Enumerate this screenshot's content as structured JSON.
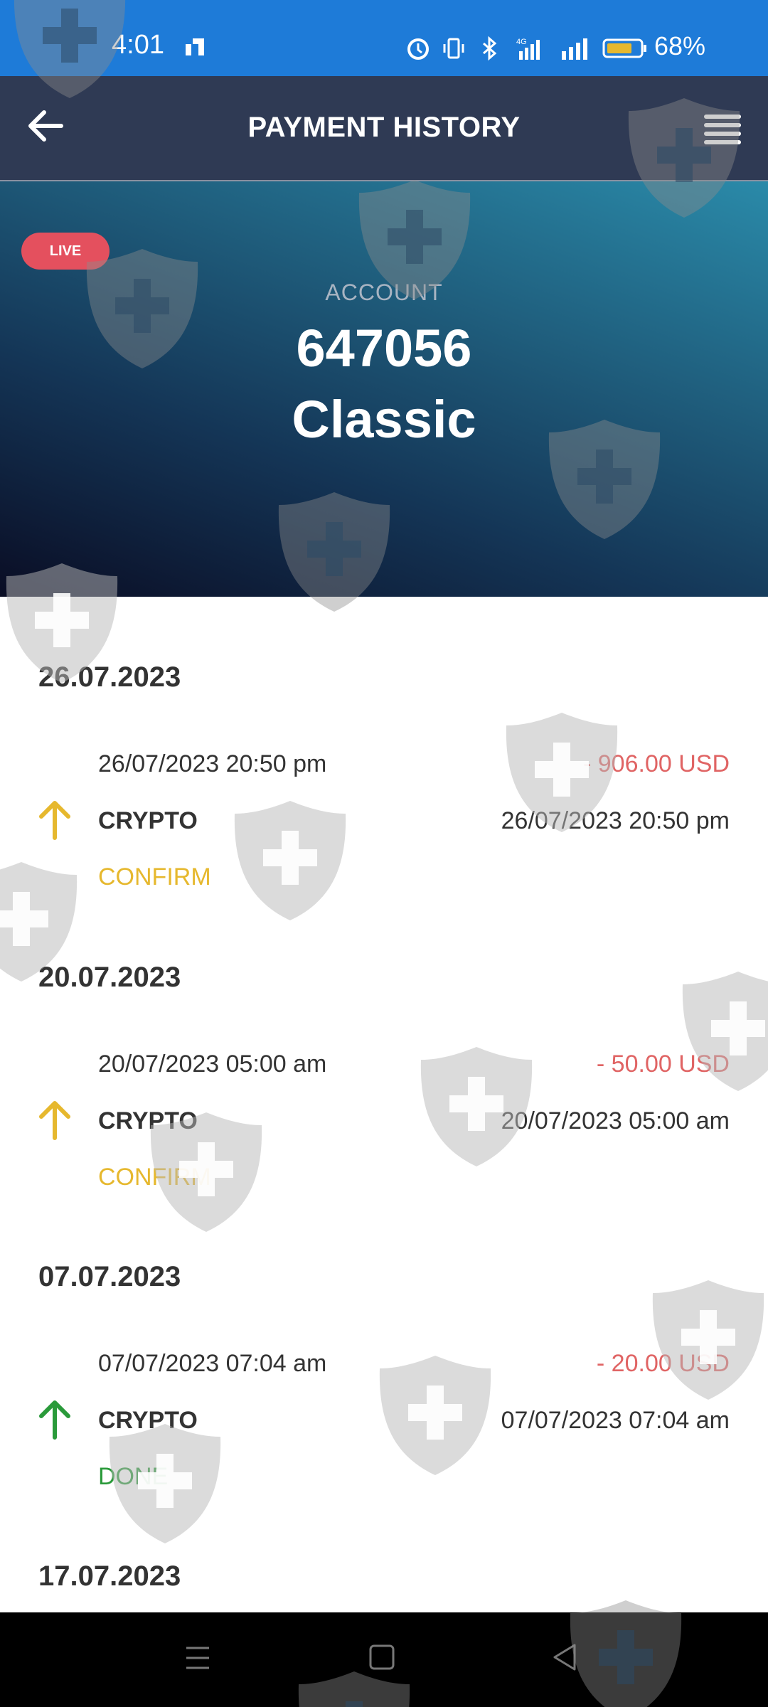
{
  "status_bar": {
    "time": "4:01",
    "battery_percent": "68%"
  },
  "header": {
    "title": "PAYMENT HISTORY"
  },
  "account": {
    "badge": "LIVE",
    "label": "ACCOUNT",
    "number": "647056",
    "type": "Classic"
  },
  "groups": [
    {
      "date": "26.07.2023",
      "transactions": [
        {
          "datetime": "26/07/2023 20:50 pm",
          "amount": "- 906.00 USD",
          "method": "CRYPTO",
          "datetime_secondary": "26/07/2023 20:50 pm",
          "status": "CONFIRM",
          "status_color": "#e6b82e",
          "icon": "arrow-up-icon"
        }
      ]
    },
    {
      "date": "20.07.2023",
      "transactions": [
        {
          "datetime": "20/07/2023 05:00 am",
          "amount": "- 50.00 USD",
          "method": "CRYPTO",
          "datetime_secondary": "20/07/2023 05:00 am",
          "status": "CONFIRM",
          "status_color": "#e6b82e",
          "icon": "arrow-up-icon"
        }
      ]
    },
    {
      "date": "07.07.2023",
      "transactions": [
        {
          "datetime": "07/07/2023 07:04 am",
          "amount": "- 20.00 USD",
          "method": "CRYPTO",
          "datetime_secondary": "07/07/2023 07:04 am",
          "status": "DONE",
          "status_color": "#2a9a3a",
          "icon": "arrow-up-icon"
        }
      ]
    },
    {
      "date": "17.07.2023",
      "transactions": []
    }
  ],
  "colors": {
    "status_bar": "#1e7bd8",
    "header": "#2f3a54",
    "live_badge": "#e4505e",
    "amount_negative": "#e06464",
    "confirm": "#e6b82e",
    "done": "#2a9a3a"
  }
}
